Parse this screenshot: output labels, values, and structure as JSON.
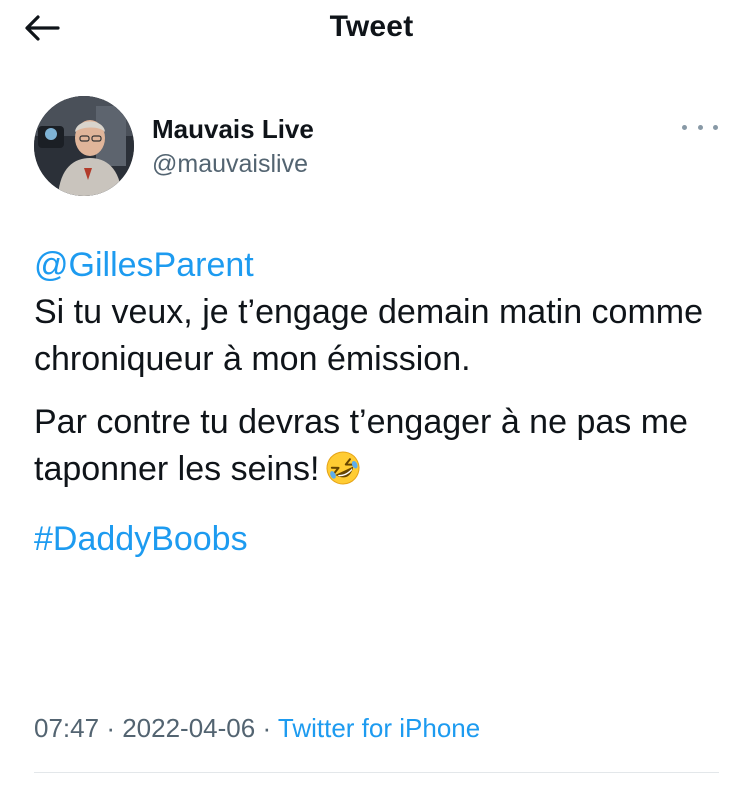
{
  "header": {
    "title": "Tweet",
    "back_icon": "arrow-left-icon"
  },
  "author": {
    "display_name": "Mauvais Live",
    "handle": "@mauvaislive",
    "avatar_icon": "avatar-photo"
  },
  "tweet": {
    "mention": "@GillesParent",
    "line1": "Si tu veux, je t’engage demain matin comme chroniqueur à mon émission.",
    "line2": "Par contre tu devras t’engager à ne pas me taponner les seins!",
    "emoji_icon": "rolling-on-floor-laughing-emoji",
    "hashtag": "#DaddyBoobs"
  },
  "meta": {
    "time": "07:47",
    "separator": "·",
    "date": "2022-04-06",
    "source": "Twitter for iPhone"
  },
  "colors": {
    "link": "#1d9bf0",
    "secondary_text": "#536471",
    "primary_text": "#0f1419"
  }
}
